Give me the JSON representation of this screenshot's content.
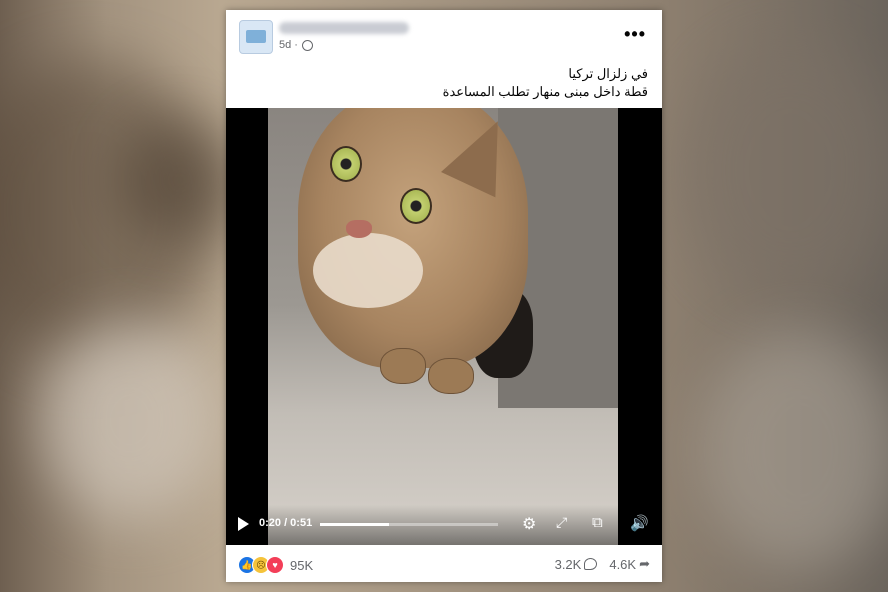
{
  "post": {
    "time_label": "5d ·",
    "more_label": "•••",
    "caption_line1": "في زلزال تركيا",
    "caption_line2": "قطة داخل مبنى منهار تطلب المساعدة"
  },
  "video": {
    "time_display": "0:20 / 0:51",
    "progress": 0.39,
    "icons": [
      "play-icon",
      "settings-icon",
      "fullscreen-icon",
      "miniplayer-icon",
      "volume-icon"
    ]
  },
  "footer": {
    "reaction_count": "95K",
    "comment_count": "3.2K",
    "share_count": "4.6K",
    "reaction_icons": [
      "like-icon",
      "sad-icon",
      "love-icon"
    ]
  },
  "colors": {
    "like": "#1b74e4",
    "sad": "#f5c33b",
    "love": "#f33e58",
    "secondary_text": "#65676b"
  }
}
